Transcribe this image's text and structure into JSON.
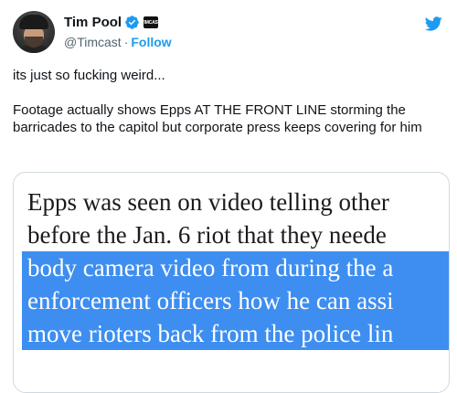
{
  "author": {
    "display_name": "Tim Pool",
    "handle": "@Timcast",
    "separator": "·",
    "follow_label": "Follow",
    "verified_color": "#1d9bf0",
    "affiliate_badge_text": "TIMCAST"
  },
  "tweet": {
    "paragraphs": [
      "its just so fucking weird...",
      "Footage actually shows Epps AT THE FRONT LINE storming the barricades to the capitol but corporate press keeps covering for him"
    ]
  },
  "media": {
    "lines": [
      {
        "text": "Epps was seen on video telling other",
        "highlighted": false
      },
      {
        "text": "before the Jan. 6 riot that they neede",
        "highlighted": false
      },
      {
        "text": "body camera video from during the a",
        "highlighted": true
      },
      {
        "text": "enforcement officers how he can assi",
        "highlighted": true
      },
      {
        "text": "move rioters back from the police lin",
        "highlighted": true
      }
    ],
    "highlight_color": "#3d8ef0"
  },
  "colors": {
    "twitter_blue": "#1d9bf0",
    "text_primary": "#0f1419",
    "text_secondary": "#536471"
  }
}
